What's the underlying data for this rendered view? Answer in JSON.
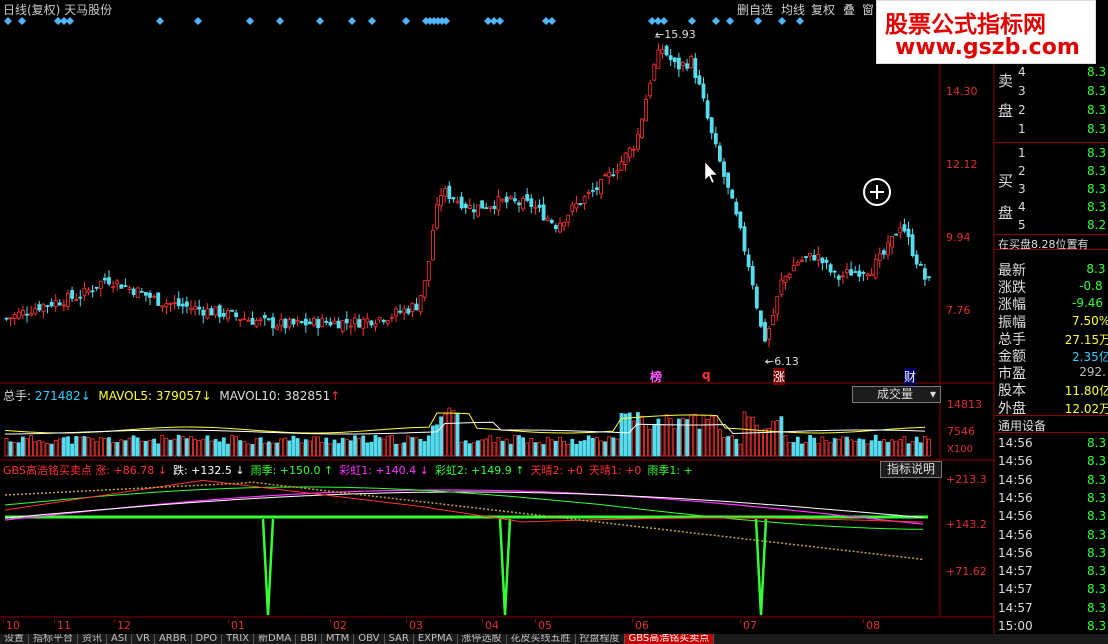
{
  "topbar": {
    "title": "日线(复权)  天马股份",
    "buttons": [
      "删自选",
      "均线",
      "复权",
      "叠",
      "窗"
    ]
  },
  "watermark": {
    "line1": "股票公式指标网",
    "line2": "www.gszb.com"
  },
  "price_axis": {
    "ticks": [
      "14.30",
      "12.12",
      "9.94",
      "7.76"
    ]
  },
  "price_annotations": {
    "high": "15.93",
    "low": "6.13"
  },
  "event_markers": [
    "榜",
    "q",
    "涨",
    "财"
  ],
  "volume_legend": {
    "total_label": "总手:",
    "total_value": "271482",
    "mavol5_label": "MAVOL5:",
    "mavol5_value": "379057",
    "mavol10_label": "MAVOL10:",
    "mavol10_value": "382851",
    "dropdown": "成交量"
  },
  "volume_axis": {
    "ticks": [
      "14813",
      "7546",
      "X100"
    ]
  },
  "indicator_legend": {
    "items": [
      {
        "text": "GBS高浩铭买卖点 涨: +86.78",
        "arrow": "↓",
        "color": "#ff3030"
      },
      {
        "text": "跌: +132.5",
        "arrow": "↓",
        "color": "#ffffff"
      },
      {
        "text": "雨季: +150.0",
        "arrow": "↑",
        "color": "#33ff33"
      },
      {
        "text": "彩虹1: +140.4",
        "arrow": "↓",
        "color": "#ff33ff"
      },
      {
        "text": "彩虹2: +149.9",
        "arrow": "↑",
        "color": "#33ff33"
      },
      {
        "text": "天晴2: +0",
        "arrow": "",
        "color": "#ff3030"
      },
      {
        "text": "天晴1: +0",
        "arrow": "",
        "color": "#ff3030"
      },
      {
        "text": "雨季1: +",
        "arrow": "",
        "color": "#33ff33"
      }
    ],
    "help_button": "指标说明"
  },
  "indicator_axis": {
    "ticks": [
      "+213.3",
      "+143.2",
      "+71.62"
    ]
  },
  "date_axis": [
    "10",
    "11",
    "12",
    "01",
    "02",
    "03",
    "04",
    "05",
    "06",
    "07",
    "08"
  ],
  "right_panel": {
    "sell_label_1": "卖",
    "sell_label_2": "盘",
    "buy_label_1": "买",
    "buy_label_2": "盘",
    "sell_rows": [
      {
        "n": "4",
        "p": "8.3"
      },
      {
        "n": "3",
        "p": "8.3"
      },
      {
        "n": "2",
        "p": "8.3"
      },
      {
        "n": "1",
        "p": "8.3"
      }
    ],
    "buy_rows": [
      {
        "n": "1",
        "p": "8.3"
      },
      {
        "n": "2",
        "p": "8.3"
      },
      {
        "n": "3",
        "p": "8.3"
      },
      {
        "n": "4",
        "p": "8.3"
      },
      {
        "n": "5",
        "p": "8.2"
      }
    ],
    "order_info": "在买盘8.28位置有",
    "stats": [
      {
        "k": "最新",
        "v": "8.3",
        "c": "#33ff33"
      },
      {
        "k": "涨跌",
        "v": "-0.8",
        "c": "#33ff33"
      },
      {
        "k": "涨幅",
        "v": "-9.46",
        "c": "#33ff33"
      },
      {
        "k": "振幅",
        "v": "7.50%",
        "c": "#ffff33"
      },
      {
        "k": "总手",
        "v": "27.15万",
        "c": "#ffff33"
      },
      {
        "k": "金额",
        "v": "2.35亿",
        "c": "#33ccff"
      },
      {
        "k": "市盈",
        "v": "292.",
        "c": "#c0c0c0"
      },
      {
        "k": "股本",
        "v": "11.80亿",
        "c": "#ffff33"
      },
      {
        "k": "外盘",
        "v": "12.02万",
        "c": "#ffff33"
      }
    ],
    "equipment": "通用设备",
    "ticks": [
      {
        "t": "14:56",
        "p": "8.3"
      },
      {
        "t": "14:56",
        "p": "8.3"
      },
      {
        "t": "14:56",
        "p": "8.3"
      },
      {
        "t": "14:56",
        "p": "8.3"
      },
      {
        "t": "14:56",
        "p": "8.3"
      },
      {
        "t": "14:56",
        "p": "8.3"
      },
      {
        "t": "14:56",
        "p": "8.3"
      },
      {
        "t": "14:57",
        "p": "8.3"
      },
      {
        "t": "14:57",
        "p": "8.3"
      },
      {
        "t": "14:57",
        "p": "8.3"
      },
      {
        "t": "15:00",
        "p": "8.3"
      }
    ]
  },
  "bottom_tabs": [
    "设置",
    "指标平台",
    "资讯",
    "ASI",
    "VR",
    "ARBR",
    "DPO",
    "TRIX",
    "新DMA",
    "BBI",
    "MTM",
    "OBV",
    "SAR",
    "EXPMA",
    "涨停选股",
    "花皮买线五胜",
    "控盘程度",
    "GBS高浩铭买卖点"
  ],
  "bottom_tabs_active": "GBS高浩铭买卖点",
  "colors": {
    "up": "#ff3333",
    "down": "#55ddee",
    "axis": "#8b0000",
    "green": "#33ff33",
    "yellow": "#ffff33"
  }
}
